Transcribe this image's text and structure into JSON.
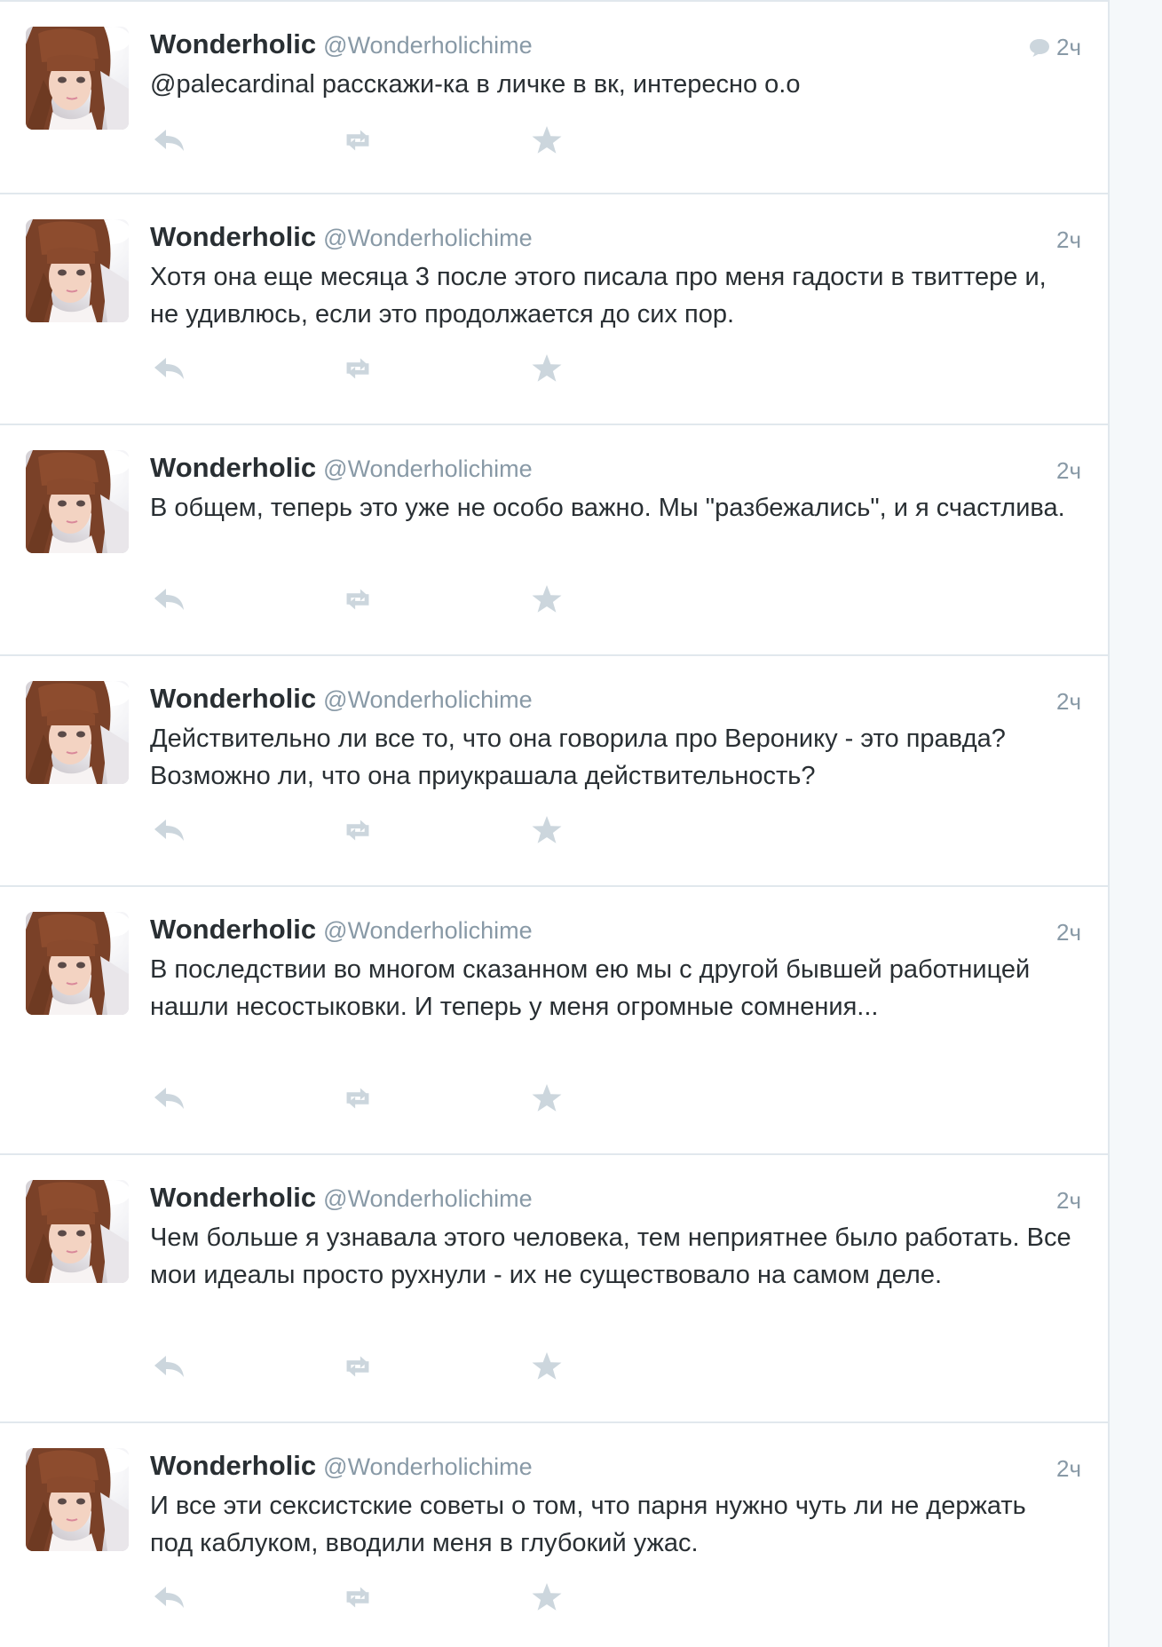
{
  "author": {
    "fullname": "Wonderholic",
    "username": "@Wonderholichime"
  },
  "colors": {
    "text": "#292f33",
    "secondary": "#8899a6",
    "icon": "#ccd6dd",
    "divider": "#e1e8ed"
  },
  "tweets": [
    {
      "time": "2ч",
      "has_conversation_icon": true,
      "text": "@palecardinal расскажи-ка в личке в вк, интересно о.о"
    },
    {
      "time": "2ч",
      "text": "Хотя она еще месяца 3 после этого писала про меня гадости в твиттере и, не удивлюсь, если это продолжается до сих пор."
    },
    {
      "time": "2ч",
      "text": "В общем, теперь это уже не особо важно. Мы \"разбежались\", и я счастлива."
    },
    {
      "time": "2ч",
      "text": "Действительно ли все то, что она говорила про Веронику - это правда? Возможно ли, что она приукрашала действительность?"
    },
    {
      "time": "2ч",
      "text": "В последствии во многом сказанном ею мы с другой бывшей работницей нашли несостыковки. И теперь у меня огромные сомнения..."
    },
    {
      "time": "2ч",
      "text": "Чем больше я узнавала этого человека, тем неприятнее было работать. Все мои идеалы просто рухнули - их не существовало на самом деле."
    },
    {
      "time": "2ч",
      "text": "И все эти сексистские советы о том, что парня нужно чуть ли не держать под каблуком, вводили меня в глубокий ужас."
    }
  ]
}
